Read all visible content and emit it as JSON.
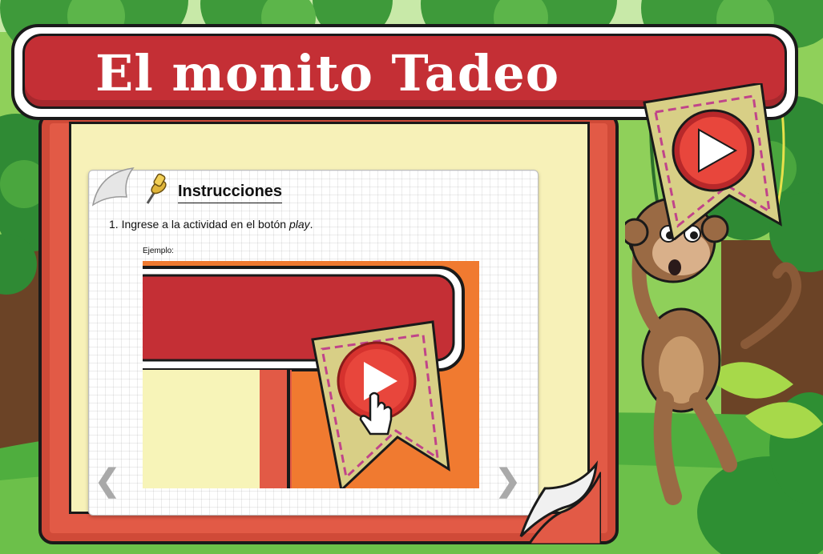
{
  "app": {
    "title": "El monito Tadeo"
  },
  "instructions": {
    "heading": "Instrucciones",
    "step_1_prefix": "1. Ingrese a la actividad en el botón ",
    "step_1_emphasis": "play",
    "step_1_suffix": ".",
    "example_label": "Ejemplo:"
  },
  "navigation": {
    "prev_arrow": "❮",
    "next_arrow": "❯"
  },
  "icons": {
    "play": "play-icon",
    "pushpin": "pushpin-icon",
    "hand_cursor": "hand-cursor-icon",
    "page_curl": "page-curl-icon"
  },
  "colors": {
    "banner_red": "#c42f35",
    "book_red": "#e25a46",
    "page_yellow": "#f7f1b8",
    "badge_gold": "#d8cf86",
    "play_red": "#d6322e",
    "jungle_green": "#7cc24a",
    "trunk_brown": "#6b4326",
    "example_orange": "#f07a30"
  }
}
